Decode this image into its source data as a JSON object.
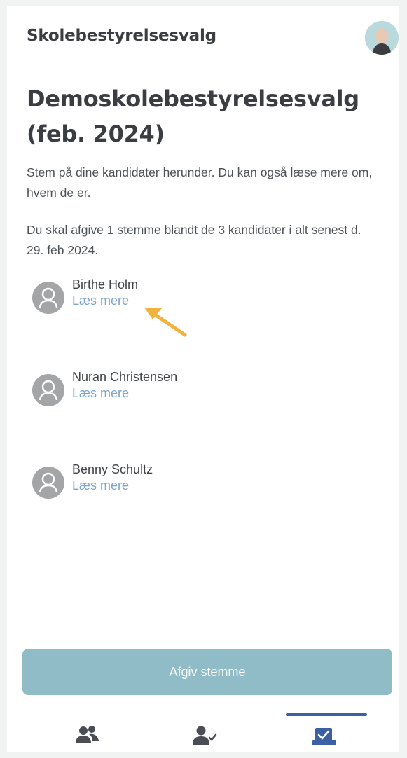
{
  "header": {
    "app_title": "Skolebestyrelsesvalg",
    "avatar_icon": "user-avatar"
  },
  "election": {
    "title": "Demoskolebestyrelsesvalg (feb. 2024)",
    "intro": "Stem på dine kandidater herunder. Du kan også læse mere om, hvem de er.",
    "instructions": "Du skal afgive 1 stemme blandt de 3 kandidater i alt senest d. 29. feb 2024."
  },
  "candidates": [
    {
      "name": "Birthe Holm",
      "link": "Læs mere",
      "icon": "person-icon"
    },
    {
      "name": "Nuran Christensen",
      "link": "Læs mere",
      "icon": "person-icon"
    },
    {
      "name": "Benny Schultz",
      "link": "Læs mere",
      "icon": "person-icon"
    }
  ],
  "annotation": {
    "icon": "arrow-icon",
    "color": "#f2b33d"
  },
  "actions": {
    "submit_label": "Afgiv stemme"
  },
  "bottom_nav": {
    "items": [
      {
        "icon": "group-icon",
        "active": false
      },
      {
        "icon": "user-check-icon",
        "active": false
      },
      {
        "icon": "ballot-check-icon",
        "active": true
      }
    ],
    "active_color": "#3d5fa3"
  },
  "colors": {
    "primary_button": "#8fbcc7",
    "link": "#7ba4c7",
    "text": "#3a3d42"
  }
}
